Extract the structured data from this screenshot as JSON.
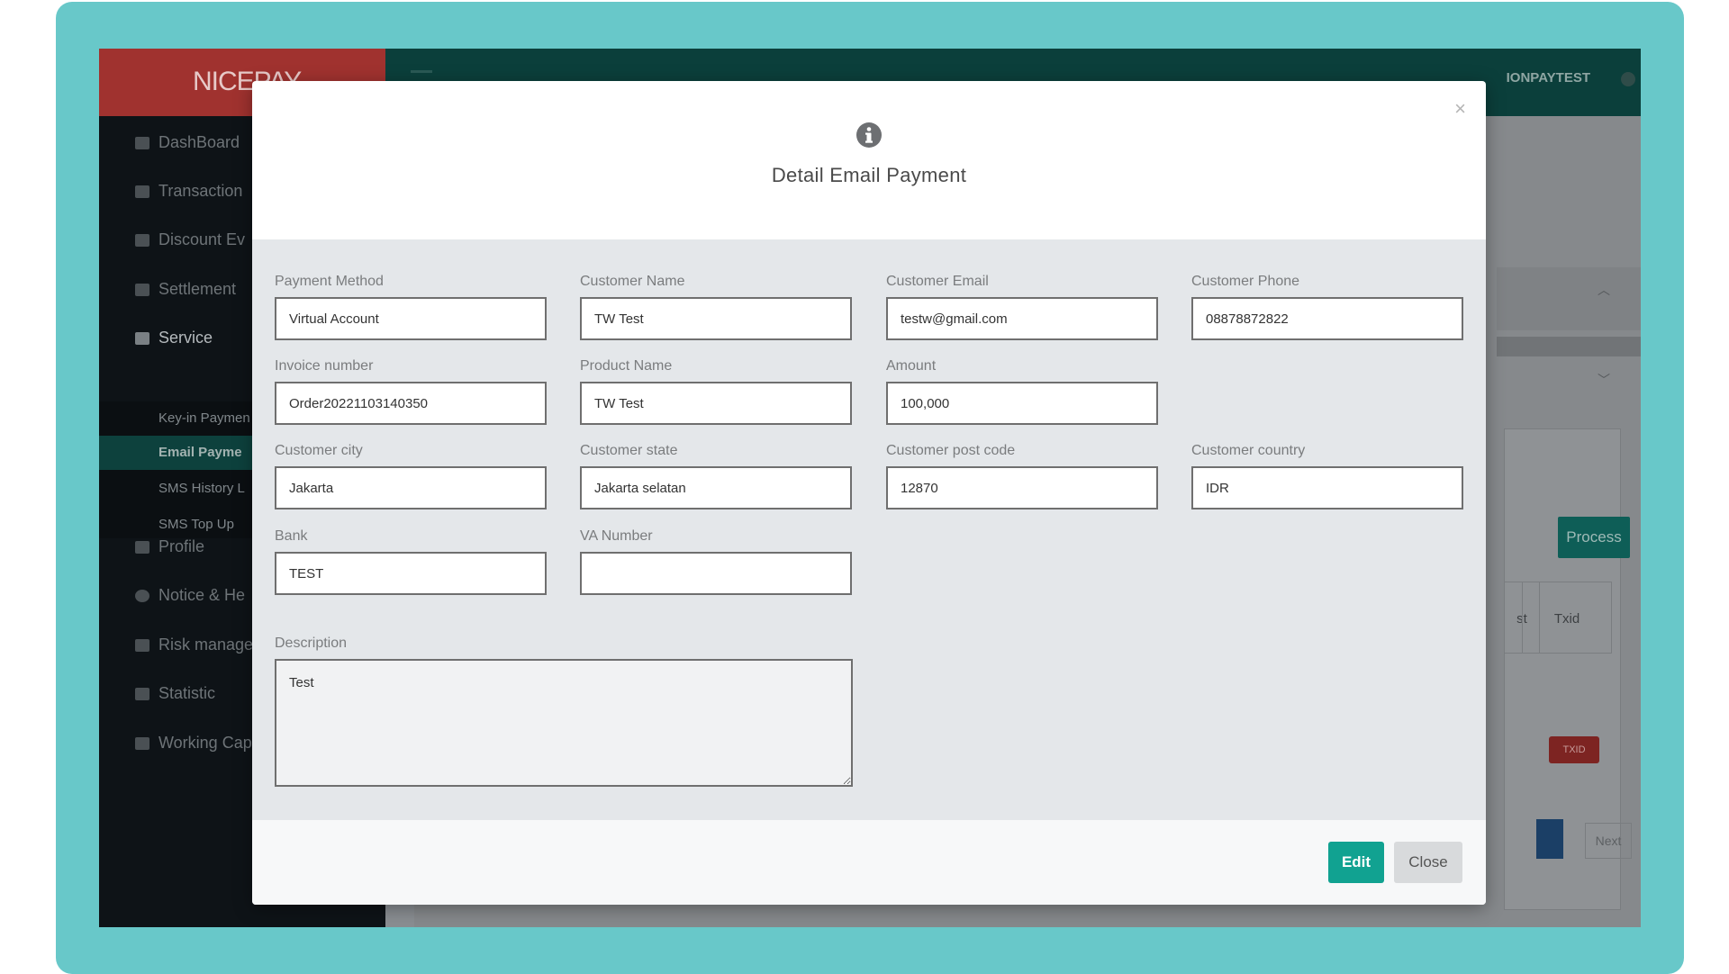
{
  "background": {
    "brand": "NICEPAY",
    "user": "IONPAYTEST",
    "sidebar": [
      {
        "label": "DashBoard"
      },
      {
        "label": "Transaction"
      },
      {
        "label": "Discount Ev"
      },
      {
        "label": "Settlement"
      },
      {
        "label": "Service"
      },
      {
        "label": "Profile"
      },
      {
        "label": "Notice & He"
      },
      {
        "label": "Risk manage"
      },
      {
        "label": "Statistic"
      },
      {
        "label": "Working Cap"
      }
    ],
    "service_submenu": [
      {
        "label": "Key-in Paymen"
      },
      {
        "label": "Email Payme"
      },
      {
        "label": "SMS History L"
      },
      {
        "label": "SMS Top Up"
      }
    ],
    "process_button": "Process",
    "col_partial": "st",
    "col_txid": "Txid",
    "txid_button": "TXID",
    "next_button": "Next"
  },
  "modal": {
    "title": "Detail Email Payment",
    "close_symbol": "×",
    "fields": {
      "payment_method": {
        "label": "Payment Method",
        "value": "Virtual Account"
      },
      "customer_name": {
        "label": "Customer Name",
        "value": "TW Test"
      },
      "customer_email": {
        "label": "Customer Email",
        "value": "testw@gmail.com"
      },
      "customer_phone": {
        "label": "Customer Phone",
        "value": "08878872822"
      },
      "invoice_number": {
        "label": "Invoice number",
        "value": "Order20221103140350"
      },
      "product_name": {
        "label": "Product Name",
        "value": "TW Test"
      },
      "amount": {
        "label": "Amount",
        "value": "100,000"
      },
      "customer_city": {
        "label": "Customer city",
        "value": "Jakarta"
      },
      "customer_state": {
        "label": "Customer state",
        "value": "Jakarta selatan"
      },
      "customer_post_code": {
        "label": "Customer post code",
        "value": "12870"
      },
      "customer_country": {
        "label": "Customer country",
        "value": "IDR"
      },
      "bank": {
        "label": "Bank",
        "value": "TEST"
      },
      "va_number": {
        "label": "VA Number",
        "value": ""
      },
      "description": {
        "label": "Description",
        "value": "Test"
      }
    },
    "buttons": {
      "edit": "Edit",
      "close": "Close"
    }
  },
  "colors": {
    "frame": "#68c8c9",
    "primary": "#11a291",
    "brand_red": "#a0322f",
    "header_dark": "#0b3f3b"
  }
}
